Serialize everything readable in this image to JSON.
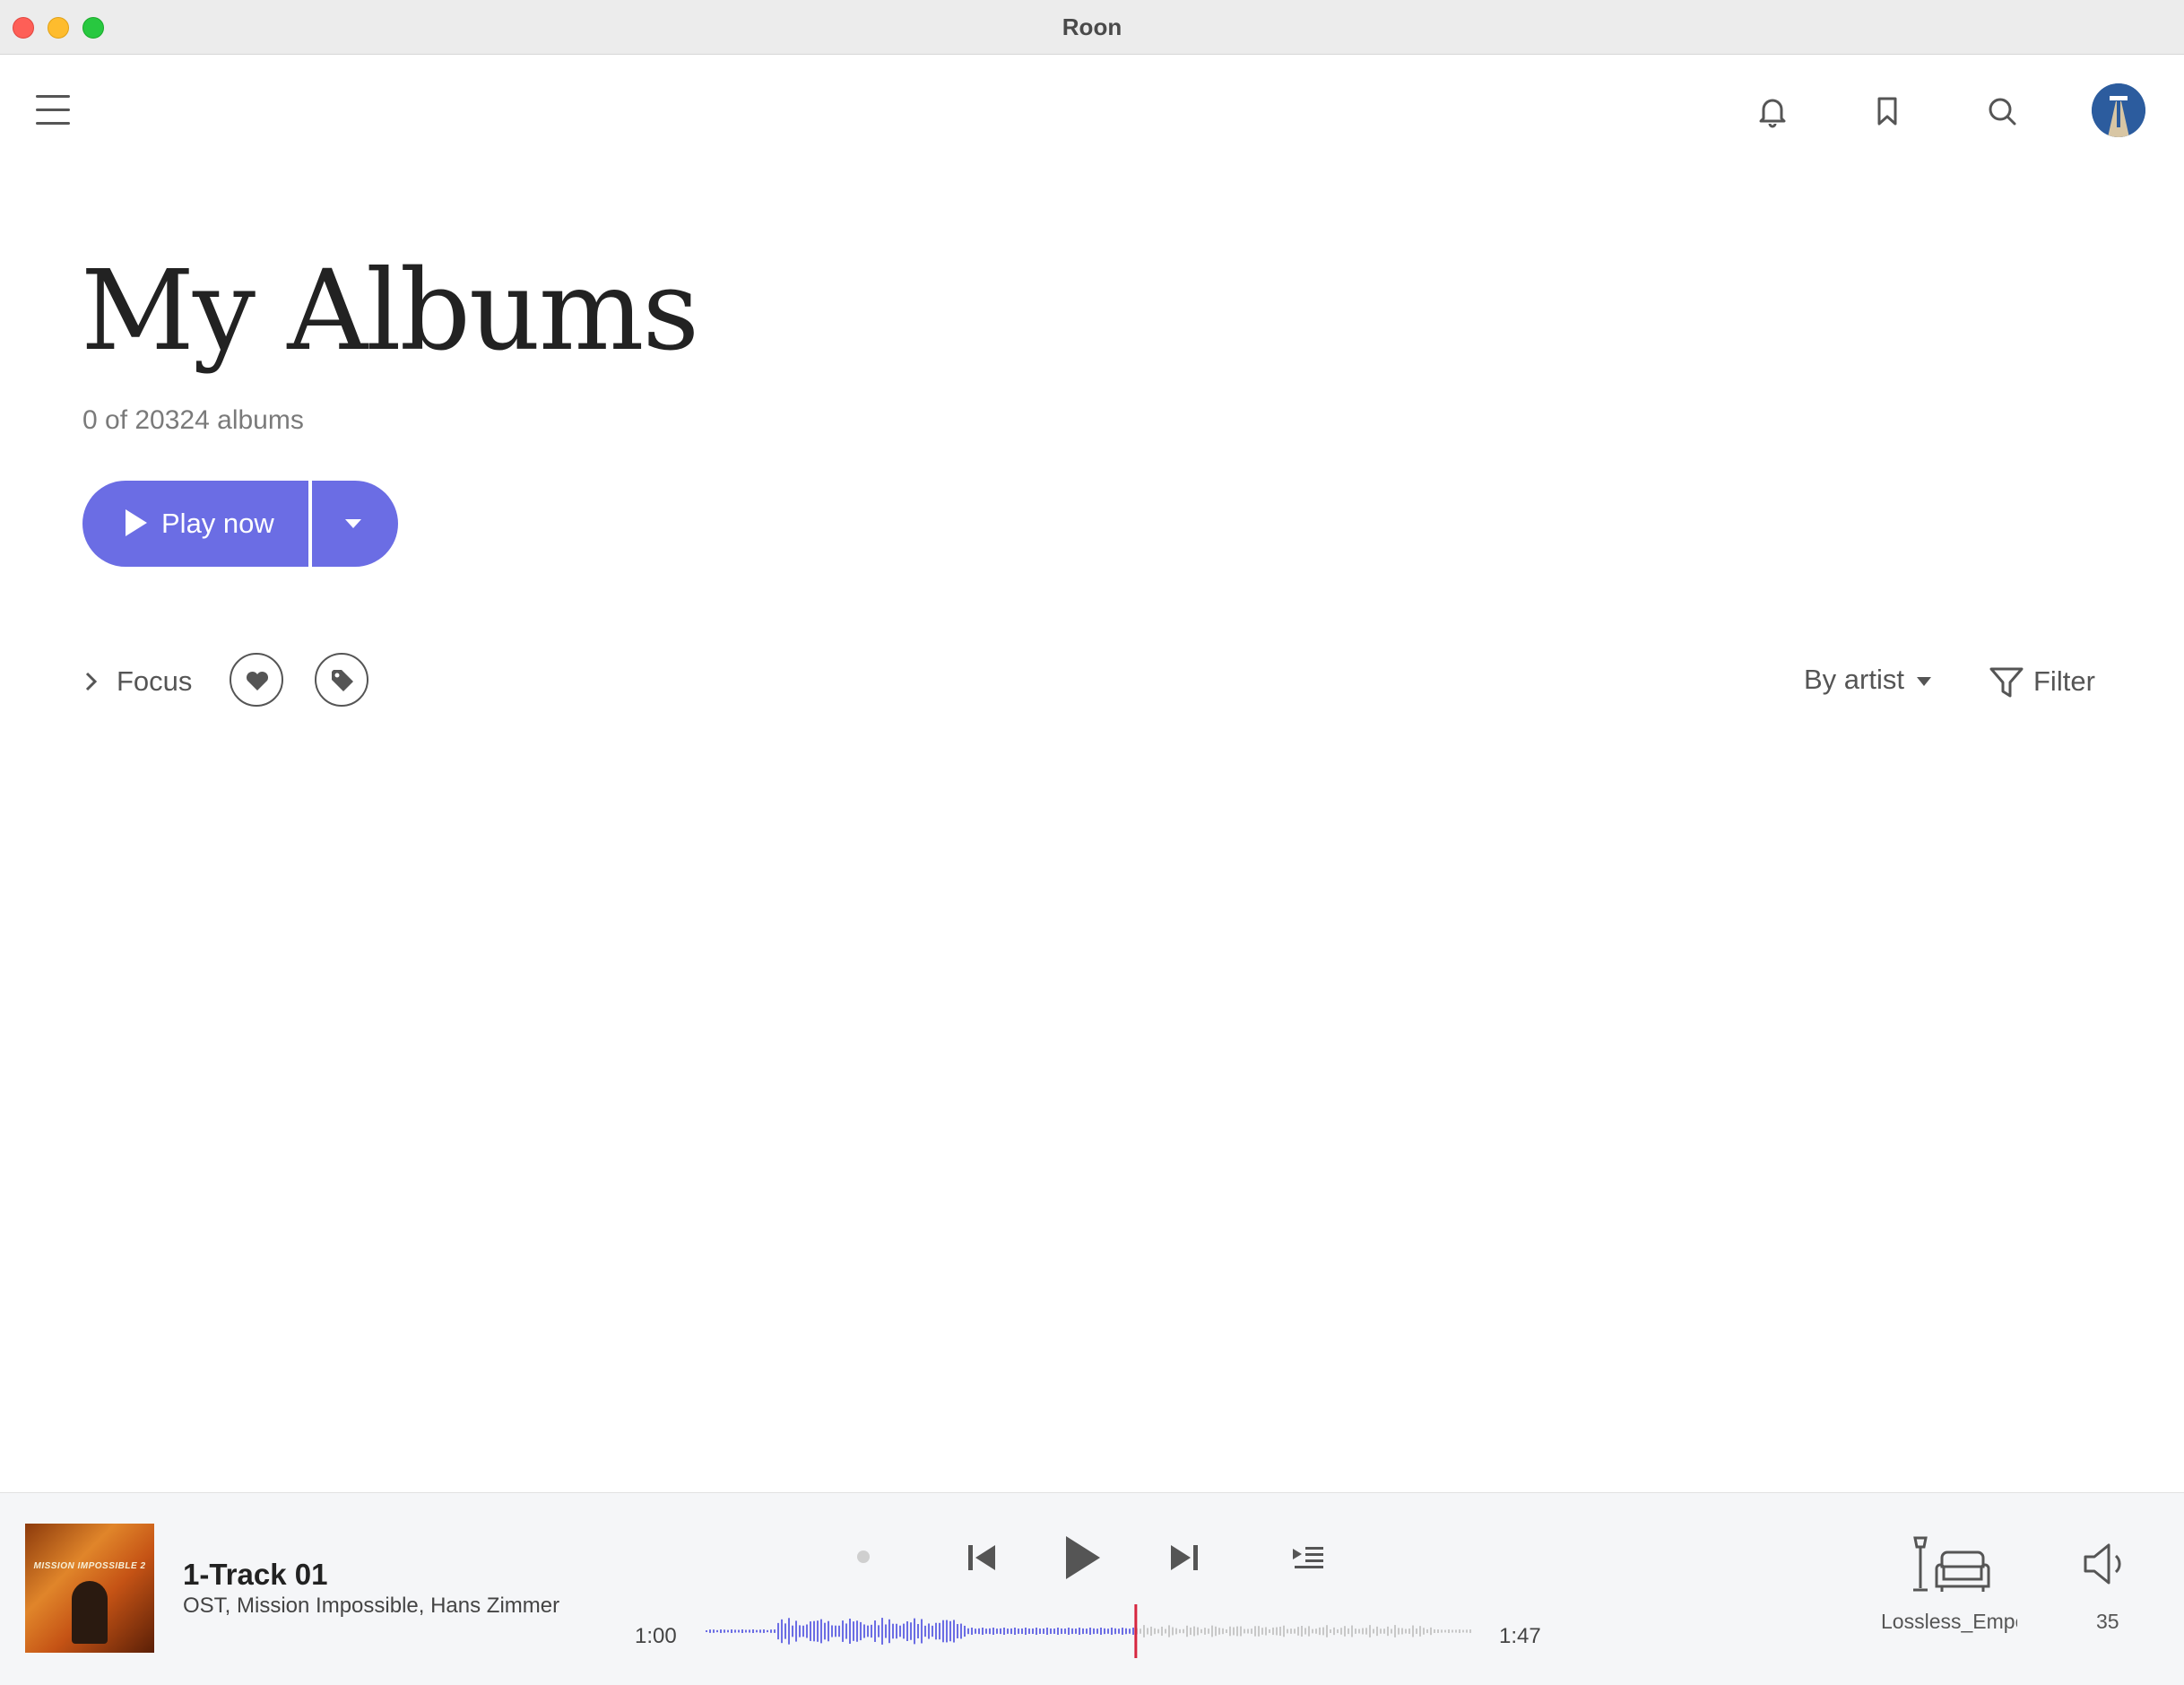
{
  "window": {
    "title": "Roon"
  },
  "page": {
    "title": "My Albums",
    "count_text": "0 of 20324 albums"
  },
  "actions": {
    "play_label": "Play now"
  },
  "toolbar": {
    "focus_label": "Focus",
    "sort_label": "By artist",
    "filter_label": "Filter"
  },
  "player": {
    "album_art_text": "MISSION IMPOSSIBLE 2",
    "track_title": "1-Track 01",
    "track_artist": "OST, Mission Impossible, Hans Zimmer",
    "elapsed": "1:00",
    "duration": "1:47",
    "progress": 0.56,
    "zone": "Lossless_Empo",
    "volume": "35"
  },
  "icons": {
    "menu": "hamburger-icon",
    "notifications": "bell-icon",
    "bookmarks": "bookmark-icon",
    "search": "search-icon",
    "favorite": "heart-icon",
    "tags": "tag-icon",
    "filter": "funnel-icon"
  },
  "colors": {
    "accent": "#6b6de4",
    "playhead": "#d6263f",
    "waveform_played": "#6b6de4",
    "waveform_unplayed": "#c8c8c8"
  }
}
